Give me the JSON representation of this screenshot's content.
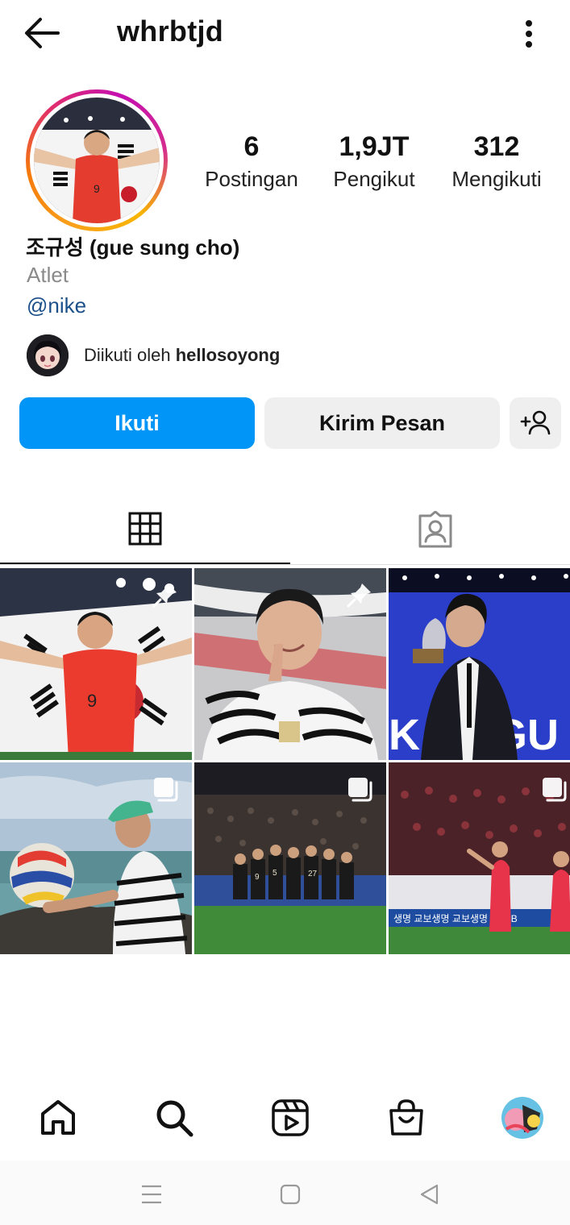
{
  "header": {
    "username": "whrbtjd",
    "back_icon": "arrow-left-icon",
    "more_icon": "more-vertical-icon"
  },
  "profile": {
    "stats": {
      "posts_count": "6",
      "posts_label": "Postingan",
      "followers_count": "1,9JT",
      "followers_label": "Pengikut",
      "following_count": "312",
      "following_label": "Mengikuti"
    },
    "full_name": "조규성 (gue sung cho)",
    "category": "Atlet",
    "link": "@nike",
    "followed_by_prefix": "Diikuti oleh ",
    "followed_by_user": "hellosoyong"
  },
  "actions": {
    "follow_label": "Ikuti",
    "message_label": "Kirim Pesan",
    "add_user_icon": "add-user-icon"
  },
  "tabs": [
    {
      "icon": "grid-icon",
      "active": true
    },
    {
      "icon": "tagged-icon",
      "active": false
    }
  ],
  "posts": [
    {
      "badge": "pin-icon"
    },
    {
      "badge": "pin-icon"
    },
    {
      "badge": "none"
    },
    {
      "badge": "carousel-icon"
    },
    {
      "badge": "carousel-icon"
    },
    {
      "badge": "carousel-icon"
    }
  ],
  "bottom_nav": [
    "home-icon",
    "search-icon",
    "reels-icon",
    "shop-icon",
    "profile-avatar"
  ],
  "colors": {
    "accent": "#0095f6",
    "secondary_button": "#efefef",
    "link": "#1b4f8a",
    "muted_text": "#8a8a8a"
  }
}
